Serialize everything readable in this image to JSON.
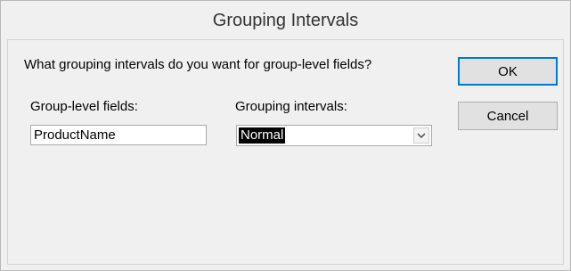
{
  "window": {
    "title": "Grouping Intervals"
  },
  "dialog": {
    "prompt": "What grouping intervals do you want for group-level fields?",
    "group_fields_label": "Group-level fields:",
    "grouping_intervals_label": "Grouping intervals:",
    "group_field_value": "ProductName",
    "grouping_interval_selected": "Normal",
    "dropdown_icon": "chevron-down-icon"
  },
  "buttons": {
    "ok_label": "OK",
    "cancel_label": "Cancel"
  },
  "colors": {
    "accent": "#0078d7",
    "selection": "#000000"
  }
}
